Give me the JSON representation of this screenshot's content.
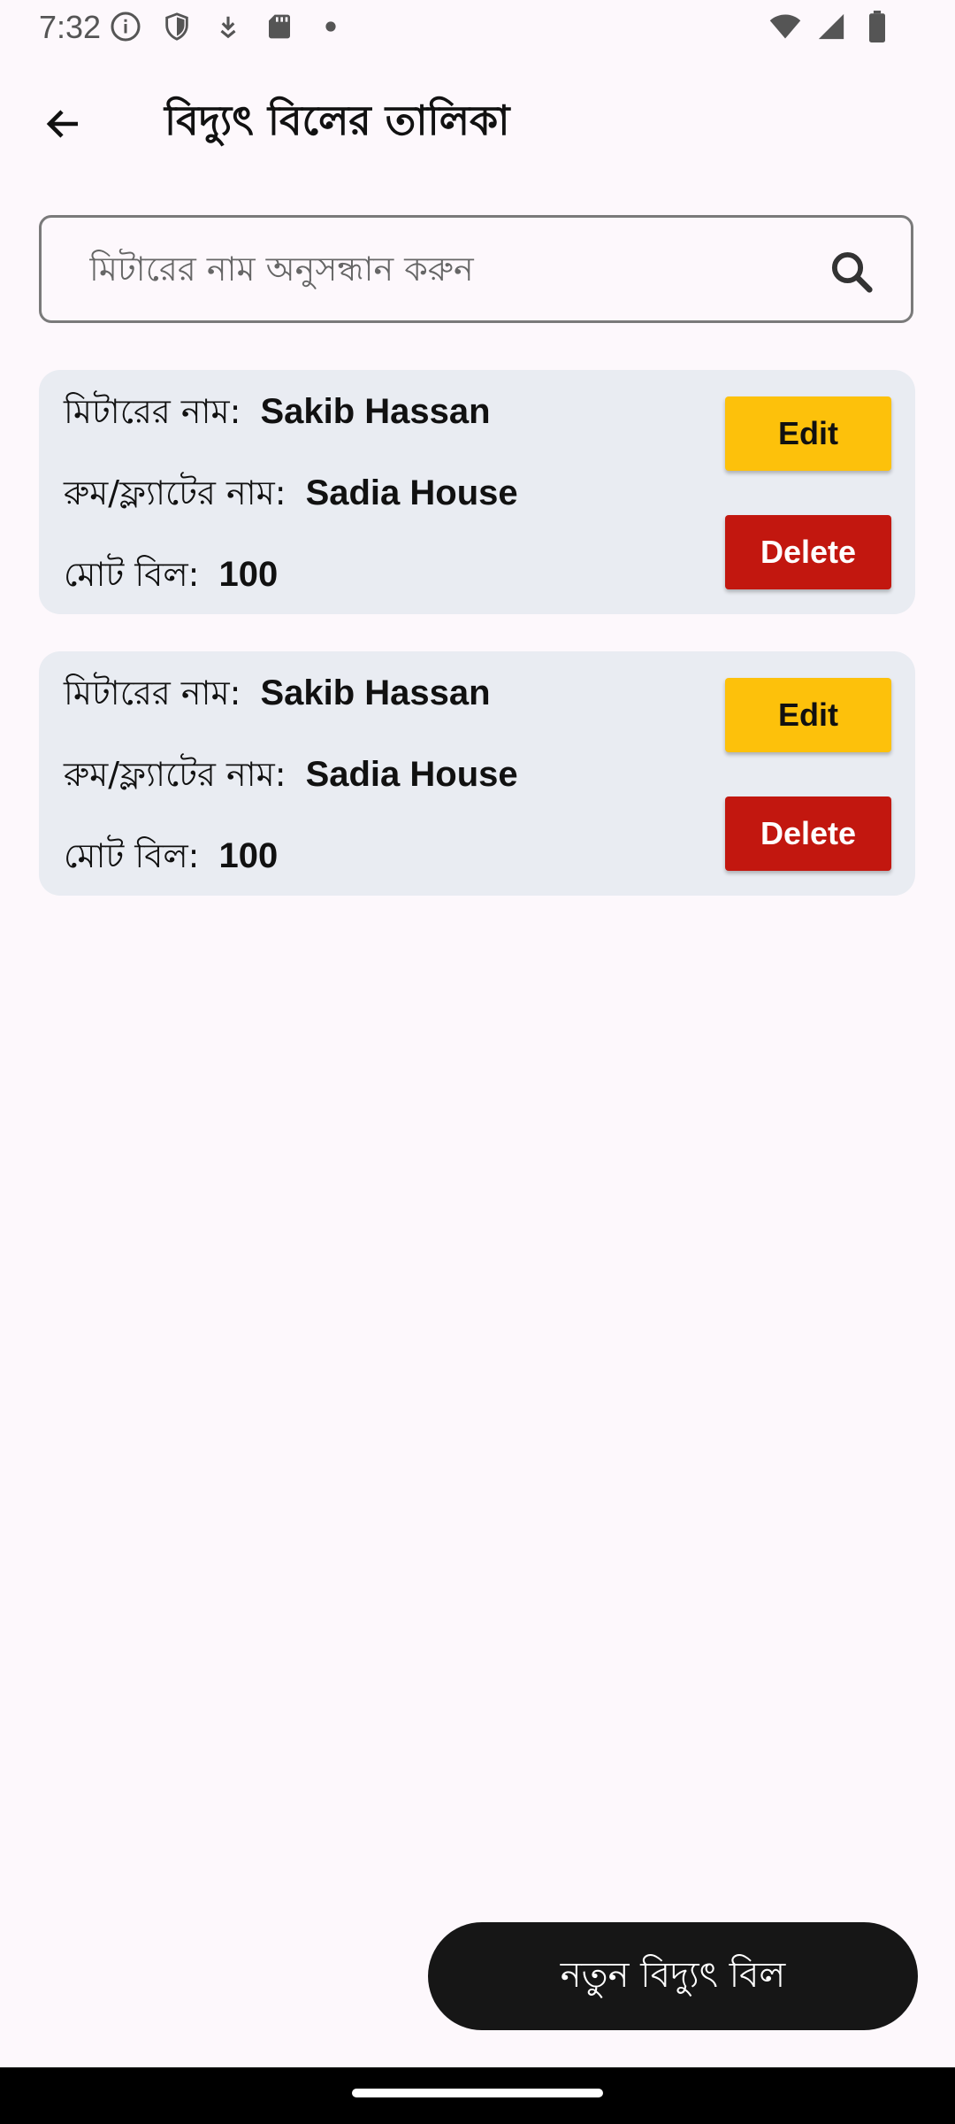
{
  "status_bar": {
    "time": "7:32",
    "left_icons": [
      "info-icon",
      "shield-icon",
      "download-icon",
      "sd-card-icon",
      "dot-icon"
    ],
    "right_icons": [
      "wifi-icon",
      "signal-icon",
      "battery-icon"
    ]
  },
  "app_bar": {
    "back_icon": "arrow-left-icon",
    "title": "বিদ্যুৎ বিলের তালিকা"
  },
  "search": {
    "placeholder": "মিটারের নাম অনুসন্ধান করুন",
    "value": "",
    "icon": "search-icon"
  },
  "cards": [
    {
      "meter_label": "মিটারের নাম:",
      "meter_value": "Sakib Hassan",
      "room_label": "রুম/ফ্ল্যাটের নাম:",
      "room_value": "Sadia House",
      "total_label": "মোট বিল:",
      "total_value": "100",
      "edit_label": "Edit",
      "delete_label": "Delete"
    },
    {
      "meter_label": "মিটারের নাম:",
      "meter_value": "Sakib Hassan",
      "room_label": "রুম/ফ্ল্যাটের নাম:",
      "room_value": "Sadia House",
      "total_label": "মোট বিল:",
      "total_value": "100",
      "edit_label": "Edit",
      "delete_label": "Delete"
    }
  ],
  "fab": {
    "label": "নতুন বিদ্যুৎ বিল"
  },
  "colors": {
    "edit": "#fdc10b",
    "delete": "#c2170f",
    "card": "#e9ecf2",
    "fab": "#161616",
    "background": "#fdf8fc"
  }
}
